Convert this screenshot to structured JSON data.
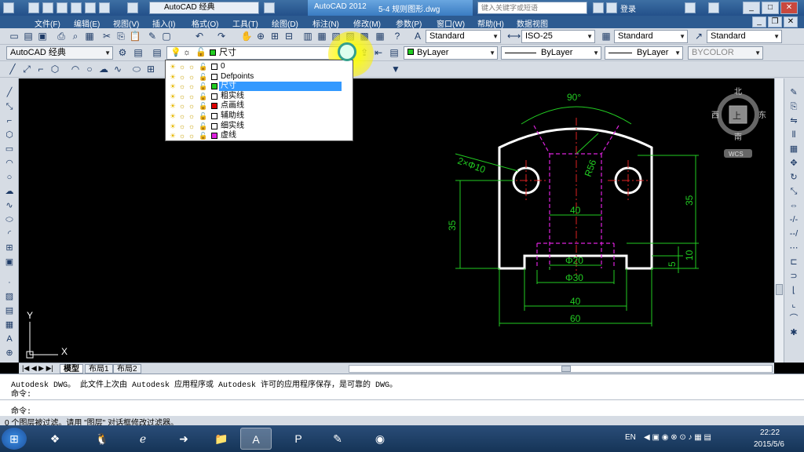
{
  "titlebar": {
    "workspace": "AutoCAD 经典",
    "app_title": "AutoCAD 2012",
    "doc_title": "5-4 规则图形.dwg",
    "search_placeholder": "键入关键字或短语",
    "login": "登录"
  },
  "menu": [
    "文件(F)",
    "编辑(E)",
    "视图(V)",
    "插入(I)",
    "格式(O)",
    "工具(T)",
    "绘图(D)",
    "标注(N)",
    "修改(M)",
    "参数(P)",
    "窗口(W)",
    "帮助(H)",
    "数据视图"
  ],
  "styles": {
    "text_style": "Standard",
    "dim_style": "ISO-25",
    "table_style": "Standard",
    "multileader_style": "Standard"
  },
  "workspace_combo": "AutoCAD 经典",
  "layer_combo": {
    "current": "尺寸",
    "current_color": "#22cc22"
  },
  "properties": {
    "color": "ByLayer",
    "linetype": "ByLayer",
    "lineweight": "ByLayer",
    "plotstyle": "BYCOLOR",
    "color_swatch": "#22cc22"
  },
  "layers": [
    {
      "name": "0",
      "color": "#ffffff",
      "selected": false
    },
    {
      "name": "Defpoints",
      "color": "#ffffff",
      "selected": false
    },
    {
      "name": "尺寸",
      "color": "#22cc22",
      "selected": true
    },
    {
      "name": "粗实线",
      "color": "#ffffff",
      "selected": false
    },
    {
      "name": "点画线",
      "color": "#dd0000",
      "selected": false
    },
    {
      "name": "辅助线",
      "color": "#ffffff",
      "selected": false
    },
    {
      "name": "细实线",
      "color": "#ffffff",
      "selected": false
    },
    {
      "name": "虚线",
      "color": "#dd22dd",
      "selected": false
    }
  ],
  "viewcube": {
    "north": "北",
    "south": "南",
    "east": "东",
    "west": "西",
    "face": "上",
    "wcs": "WCS"
  },
  "ucs": {
    "x": "X",
    "y": "Y"
  },
  "drawing": {
    "dim_angle": "90°",
    "dim_holes": "2×Φ10",
    "dim_radius": "R56",
    "dim_inner_40": "40",
    "dim_phi20": "Φ20",
    "dim_phi30": "Φ30",
    "dim_40": "40",
    "dim_60": "60",
    "dim_35_left": "35",
    "dim_35_right": "35",
    "dim_10": "10",
    "dim_5": "5"
  },
  "layout_tabs": [
    "模型",
    "布局1",
    "布局2"
  ],
  "command": {
    "history": "Autodesk DWG。  此文件上次由 Autodesk 应用程序或 Autodesk 许可的应用程序保存，是可靠的 DWG。",
    "prompt1": "命令:",
    "prompt2": "命令:"
  },
  "status": "0 个图层被过滤。请用 \"图层\" 对话框修改过滤器。",
  "taskbar": {
    "lang": "EN",
    "time": "22:22",
    "date": "2015/5/6"
  }
}
